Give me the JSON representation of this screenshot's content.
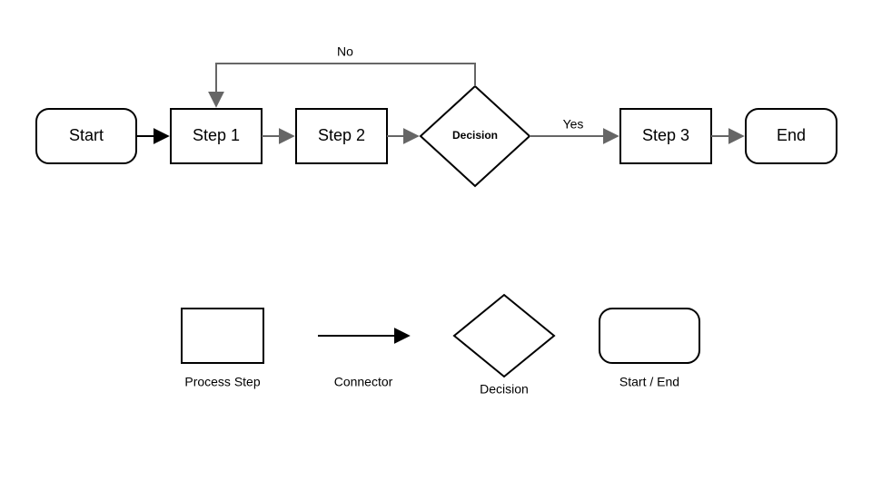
{
  "flow": {
    "nodes": {
      "start": "Start",
      "step1": "Step 1",
      "step2": "Step 2",
      "decision": "Decision",
      "step3": "Step 3",
      "end": "End"
    },
    "edges": {
      "yes": "Yes",
      "no": "No"
    }
  },
  "legend": {
    "process": "Process Step",
    "connector": "Connector",
    "decision": "Decision",
    "terminator": "Start / End"
  }
}
